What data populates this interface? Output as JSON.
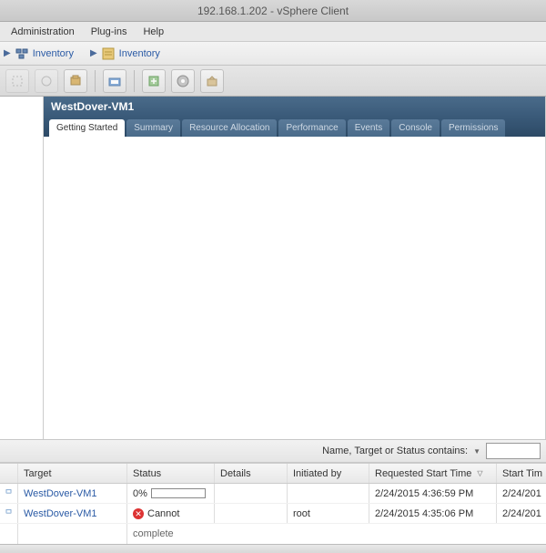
{
  "title": "192.168.1.202 - vSphere Client",
  "menu": {
    "admin": "Administration",
    "plugins": "Plug-ins",
    "help": "Help"
  },
  "breadcrumb": {
    "inv1": "Inventory",
    "inv2": "Inventory"
  },
  "host": "WestDover-VM1",
  "tabs": [
    {
      "label": "Getting Started",
      "active": true
    },
    {
      "label": "Summary"
    },
    {
      "label": "Resource Allocation"
    },
    {
      "label": "Performance"
    },
    {
      "label": "Events"
    },
    {
      "label": "Console"
    },
    {
      "label": "Permissions"
    }
  ],
  "filter_label": "Name, Target or Status contains:",
  "filter_value": "",
  "task_headers": {
    "target": "Target",
    "status": "Status",
    "details": "Details",
    "initiated": "Initiated by",
    "requested": "Requested Start Time",
    "start": "Start Tim"
  },
  "tasks": [
    {
      "target": "WestDover-VM1",
      "status_pct": "0%",
      "status_text": "",
      "details": "",
      "initiated": "",
      "requested": "2/24/2015 4:36:59 PM",
      "start": "2/24/201"
    },
    {
      "target": "WestDover-VM1",
      "status_pct": "",
      "status_text": "Cannot",
      "details": "",
      "initiated": "root",
      "requested": "2/24/2015 4:35:06 PM",
      "start": "2/24/201"
    }
  ],
  "overflow": "complete"
}
